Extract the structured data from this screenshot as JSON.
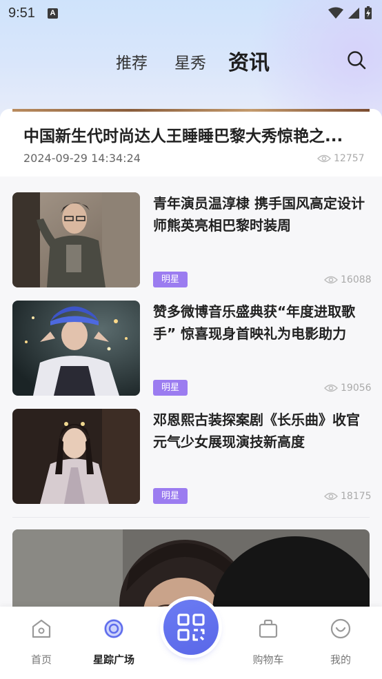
{
  "status_bar": {
    "time": "9:51",
    "notification_badge": "A"
  },
  "header": {
    "tabs": [
      {
        "label": "推荐"
      },
      {
        "label": "星秀"
      },
      {
        "label": "资讯"
      }
    ],
    "active_tab": "资讯"
  },
  "featured": {
    "title": "中国新生代时尚达人王睡睡巴黎大秀惊艳之...",
    "date": "2024-09-29 14:34:24",
    "views": "12757"
  },
  "news": [
    {
      "title": "青年演员温淳棣 携手国风高定设计师熊英亮相巴黎时装周",
      "tag": "明星",
      "views": "16088"
    },
    {
      "title": "赞多微博音乐盛典获“年度进取歌手” 惊喜现身首映礼为电影助力",
      "tag": "明星",
      "views": "19056"
    },
    {
      "title": "邓恩熙古装探案剧《长乐曲》收官 元气少女展现演技新高度",
      "tag": "明星",
      "views": "18175"
    }
  ],
  "bottom_nav": [
    {
      "label": "首页",
      "icon": "home-icon"
    },
    {
      "label": "星踪广场",
      "icon": "target-icon"
    },
    {
      "label": "",
      "icon": "qr-code-icon"
    },
    {
      "label": "购物车",
      "icon": "shopping-bag-icon"
    },
    {
      "label": "我的",
      "icon": "profile-icon"
    }
  ],
  "colors": {
    "accent": "#5e6cec",
    "tag": "#9b7cf0"
  }
}
